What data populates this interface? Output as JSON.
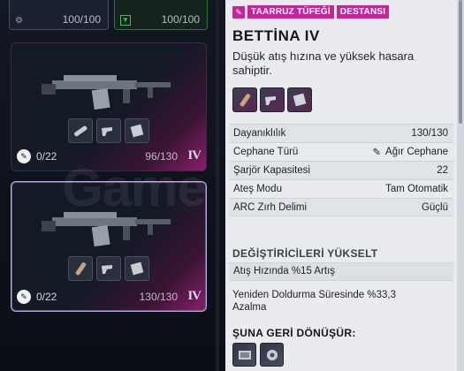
{
  "left": {
    "top_cards": [
      {
        "value": "100/100",
        "icon": "mod-icon"
      },
      {
        "value": "100/100",
        "icon": "shield-icon"
      }
    ],
    "weapons": [
      {
        "mod_count": "0/22",
        "durability": "96/130",
        "tier": "IV"
      },
      {
        "mod_count": "0/22",
        "durability": "130/130",
        "tier": "IV"
      }
    ],
    "watermark": "Game"
  },
  "detail": {
    "tags": [
      "TAARRUZ TÜFEĞİ",
      "DESTANSI"
    ],
    "name": "BETTİNA IV",
    "description": "Düşük atış hızına ve yüksek hasara sahiptir.",
    "stats": [
      {
        "label": "Dayanıklılık",
        "value": "130/130"
      },
      {
        "label": "Cephane Türü",
        "value": "Ağır Cephane"
      },
      {
        "label": "Şarjör Kapasitesi",
        "value": "22"
      },
      {
        "label": "Ateş Modu",
        "value": "Tam Otomatik"
      },
      {
        "label": "ARC Zırh Delimi",
        "value": "Güçlü"
      }
    ],
    "upgrade_heading": "DEĞİŞTİRİCİLERİ YÜKSELT",
    "upgrades": [
      "Atış Hızında %15 Artış",
      "Yeniden Doldurma Süresinde %33,3 Azalma"
    ],
    "recycle_heading": "ŞUNA GERİ DÖNÜŞÜR:"
  },
  "colors": {
    "accent": "#c8249a",
    "panel": "#e9ebee",
    "dark": "#0c0f17"
  }
}
